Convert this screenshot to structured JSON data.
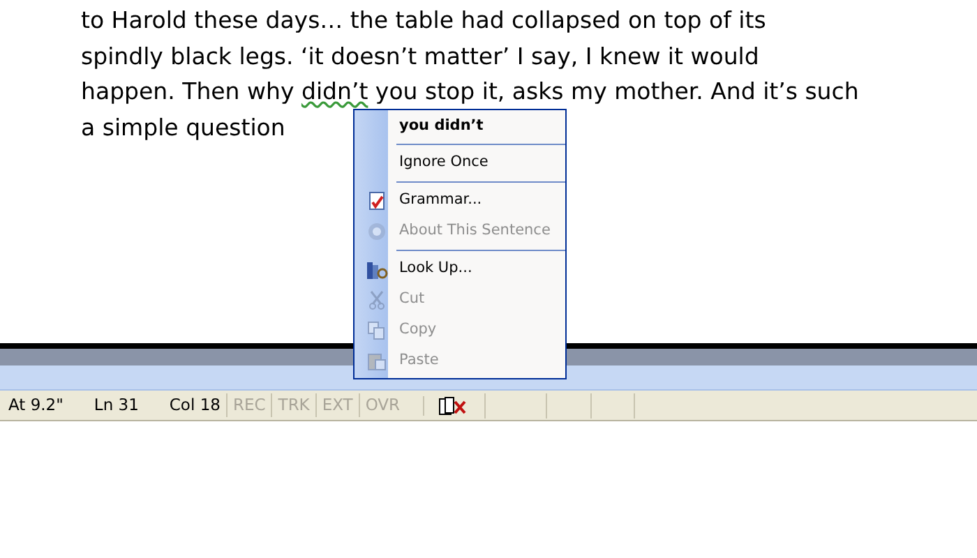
{
  "document": {
    "lines": [
      {
        "segments": [
          {
            "text": "to Harold these days… the table had collapsed on top of its",
            "flagged": false
          }
        ]
      },
      {
        "segments": [
          {
            "text": "spindly black legs. ‘it doesn’t matter’ I say, I knew it would",
            "flagged": false
          }
        ]
      },
      {
        "segments": [
          {
            "text": "happen. Then why ",
            "flagged": false
          },
          {
            "text": "didn’t",
            "flagged": true
          },
          {
            "text": " you stop it, asks my mother. And it’s such",
            "flagged": false
          }
        ]
      },
      {
        "segments": [
          {
            "text": "a simple question",
            "flagged": false
          }
        ]
      }
    ]
  },
  "context_menu": {
    "items": [
      {
        "kind": "suggestion",
        "label": "you didn’t"
      },
      {
        "kind": "separator"
      },
      {
        "kind": "plain",
        "label": "Ignore Once",
        "disabled": false
      },
      {
        "kind": "separator"
      },
      {
        "kind": "grammar",
        "label": "Grammar...",
        "disabled": false
      },
      {
        "kind": "help",
        "label": "About This Sentence",
        "disabled": true
      },
      {
        "kind": "separator"
      },
      {
        "kind": "lookup",
        "label": "Look Up...",
        "disabled": false
      },
      {
        "kind": "cut",
        "label": "Cut",
        "disabled": true
      },
      {
        "kind": "copy",
        "label": "Copy",
        "disabled": true
      },
      {
        "kind": "paste",
        "label": "Paste",
        "disabled": true
      }
    ]
  },
  "status_bar": {
    "position": [
      {
        "label": "At 9.2\""
      },
      {
        "label": "Ln 31"
      },
      {
        "label": "Col 18"
      }
    ],
    "modes": [
      {
        "label": "REC",
        "disabled": true
      },
      {
        "label": "TRK",
        "disabled": true
      },
      {
        "label": "EXT",
        "disabled": true
      },
      {
        "label": "OVR",
        "disabled": true
      }
    ]
  }
}
